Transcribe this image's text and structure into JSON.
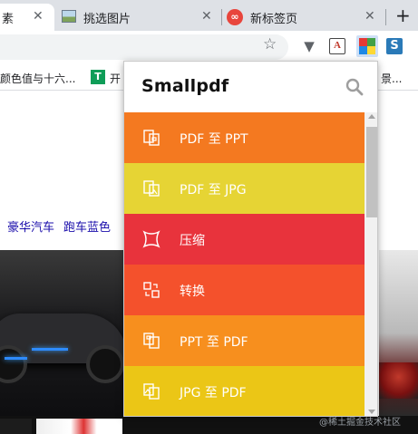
{
  "browser": {
    "tabs": [
      {
        "label": "素",
        "active": true
      },
      {
        "label": "挑选图片",
        "icon": "image-favicon"
      },
      {
        "label": "新标签页",
        "icon": "infinity-favicon"
      }
    ],
    "tab_close_glyph": "✕",
    "new_tab_glyph": "+",
    "star_glyph": "☆",
    "extensions": {
      "v_glyph": "▼",
      "a_glyph": "A",
      "s_glyph": "S",
      "grid_colors": [
        "#e53935",
        "#43a047",
        "#1e88e5",
        "#fdd835"
      ]
    }
  },
  "bookmarks": {
    "item1": "颜色值与十六...",
    "item2_icon": "T",
    "item2": "开",
    "item3": "景..."
  },
  "page": {
    "links": [
      "豪华汽车",
      "跑车蓝色"
    ],
    "watermark": "@稀土掘金技术社区"
  },
  "popup": {
    "title": "Smallpdf",
    "items": [
      {
        "label": "PDF 至 PPT",
        "color": "#f47920",
        "icon": "pdf-to-ppt-icon"
      },
      {
        "label": "PDF 至 JPG",
        "color": "#e6d434",
        "icon": "pdf-to-jpg-icon"
      },
      {
        "label": "压缩",
        "color": "#e8333c",
        "icon": "compress-icon"
      },
      {
        "label": "转换",
        "color": "#f4512c",
        "icon": "convert-icon"
      },
      {
        "label": "PPT 至 PDF",
        "color": "#f78f1e",
        "icon": "ppt-to-pdf-icon"
      },
      {
        "label": "JPG 至 PDF",
        "color": "#ebc616",
        "icon": "jpg-to-pdf-icon"
      }
    ]
  }
}
